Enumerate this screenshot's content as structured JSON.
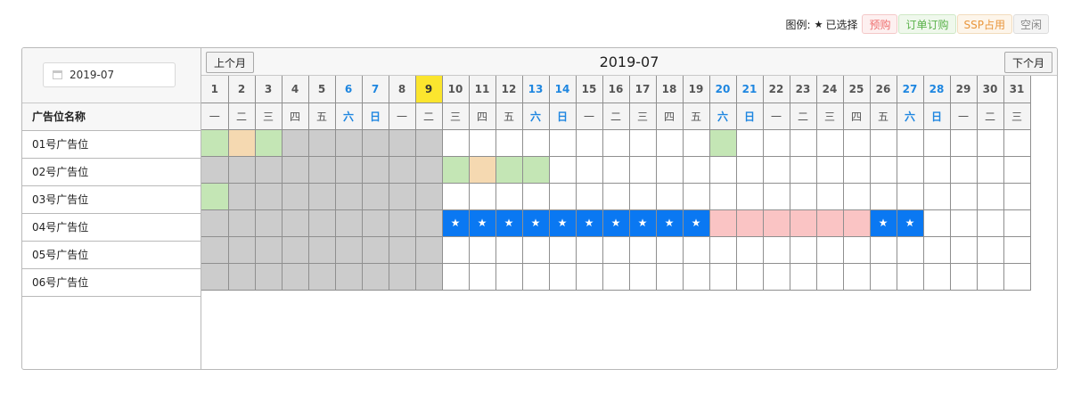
{
  "legend": {
    "title": "图例:",
    "star": "★",
    "selected_label": "已选择",
    "items": [
      {
        "label": "预购",
        "color": "#ef6f6f",
        "bg": "#fdf0f0",
        "border": "#f4c8c8"
      },
      {
        "label": "订单订购",
        "color": "#5ab24a",
        "bg": "#eff8ec",
        "border": "#cfe8c5"
      },
      {
        "label": "SSP占用",
        "color": "#e9963c",
        "bg": "#fdf5ea",
        "border": "#f2dcbd"
      },
      {
        "label": "空闲",
        "color": "#888888",
        "bg": "#f4f4f4",
        "border": "#dcdcdc"
      }
    ]
  },
  "picker": {
    "value": "2019-07"
  },
  "nav": {
    "prev": "上个月",
    "next": "下个月",
    "title": "2019-07"
  },
  "name_header": "广告位名称",
  "today": 9,
  "days": [
    1,
    2,
    3,
    4,
    5,
    6,
    7,
    8,
    9,
    10,
    11,
    12,
    13,
    14,
    15,
    16,
    17,
    18,
    19,
    20,
    21,
    22,
    23,
    24,
    25,
    26,
    27,
    28,
    29,
    30,
    31
  ],
  "weekdays": [
    "一",
    "二",
    "三",
    "四",
    "五",
    "六",
    "日",
    "一",
    "二",
    "三",
    "四",
    "五",
    "六",
    "日",
    "一",
    "二",
    "三",
    "四",
    "五",
    "六",
    "日",
    "一",
    "二",
    "三",
    "四",
    "五",
    "六",
    "日",
    "一",
    "二",
    "三"
  ],
  "weekend_days": [
    6,
    7,
    13,
    14,
    20,
    21,
    27,
    28
  ],
  "rows": [
    {
      "name": "01号广告位",
      "cells": "OSOPPPPPP----------O-----------"
    },
    {
      "name": "02号广告位",
      "cells": "PPPPPPPPPOSOO------------------"
    },
    {
      "name": "03号广告位",
      "cells": "OPPPPPPPP----------------------"
    },
    {
      "name": "04号广告位",
      "cells": "PPPPPPPPP**********RRRRRR**----"
    },
    {
      "name": "05号广告位",
      "cells": "PPPPPPPPP----------------------"
    },
    {
      "name": "06号广告位",
      "cells": "PPPPPPPPP----------------------"
    }
  ],
  "cell_legend": {
    "P": "past",
    "O": "order",
    "S": "ssp",
    "R": "preorder",
    "*": "selected",
    "-": "free"
  }
}
